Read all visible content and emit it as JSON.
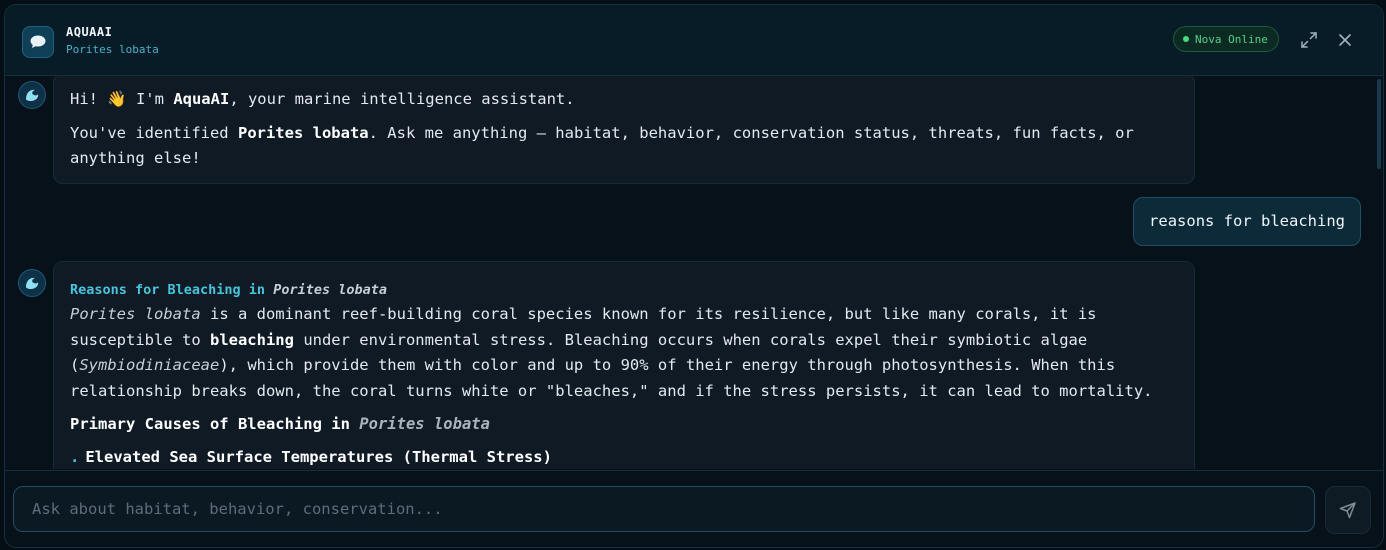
{
  "header": {
    "title": "AQUAAI",
    "subtitle": "Porites lobata",
    "status": "Nova Online",
    "expand_icon": "expand-icon",
    "close_icon": "close-icon"
  },
  "colors": {
    "accent": "#3fc7dd",
    "status_green": "#4fd08a",
    "background": "#07111a"
  },
  "messages": {
    "greeting": {
      "line1_pre": "Hi! ",
      "wave_emoji": "👋",
      "line1_mid": " I'm ",
      "line1_bold": "AquaAI",
      "line1_post": ", your marine intelligence assistant.",
      "line2_pre": "You've identified ",
      "line2_bold": "Porites lobata",
      "line2_post": ". Ask me anything — habitat, behavior, conservation status, threats, fun facts, or anything else!"
    },
    "user": {
      "text": "reasons for bleaching"
    },
    "answer": {
      "title_pre": "Reasons for Bleaching in ",
      "title_italic": "Porites lobata",
      "p_italic1": "Porites lobata",
      "p_text1": " is a dominant reef-building coral species known for its resilience, but like many corals, it is susceptible to ",
      "p_bold1": "bleaching",
      "p_text2": " under environmental stress. Bleaching occurs when corals expel their symbiotic algae (",
      "p_italic2": "Symbiodiniaceae",
      "p_text3": "), which provide them with color and up to 90% of their energy through photosynthesis. When this relationship breaks down, the coral turns white or \"bleaches,\" and if the stress persists, it can lead to mortality.",
      "h2_pre": "Primary Causes of Bleaching in ",
      "h2_italic": "Porites lobata",
      "bullet1": "Elevated Sea Surface Temperatures (Thermal Stress)"
    }
  },
  "composer": {
    "placeholder": "Ask about habitat, behavior, conservation...",
    "send_icon": "send-icon"
  }
}
